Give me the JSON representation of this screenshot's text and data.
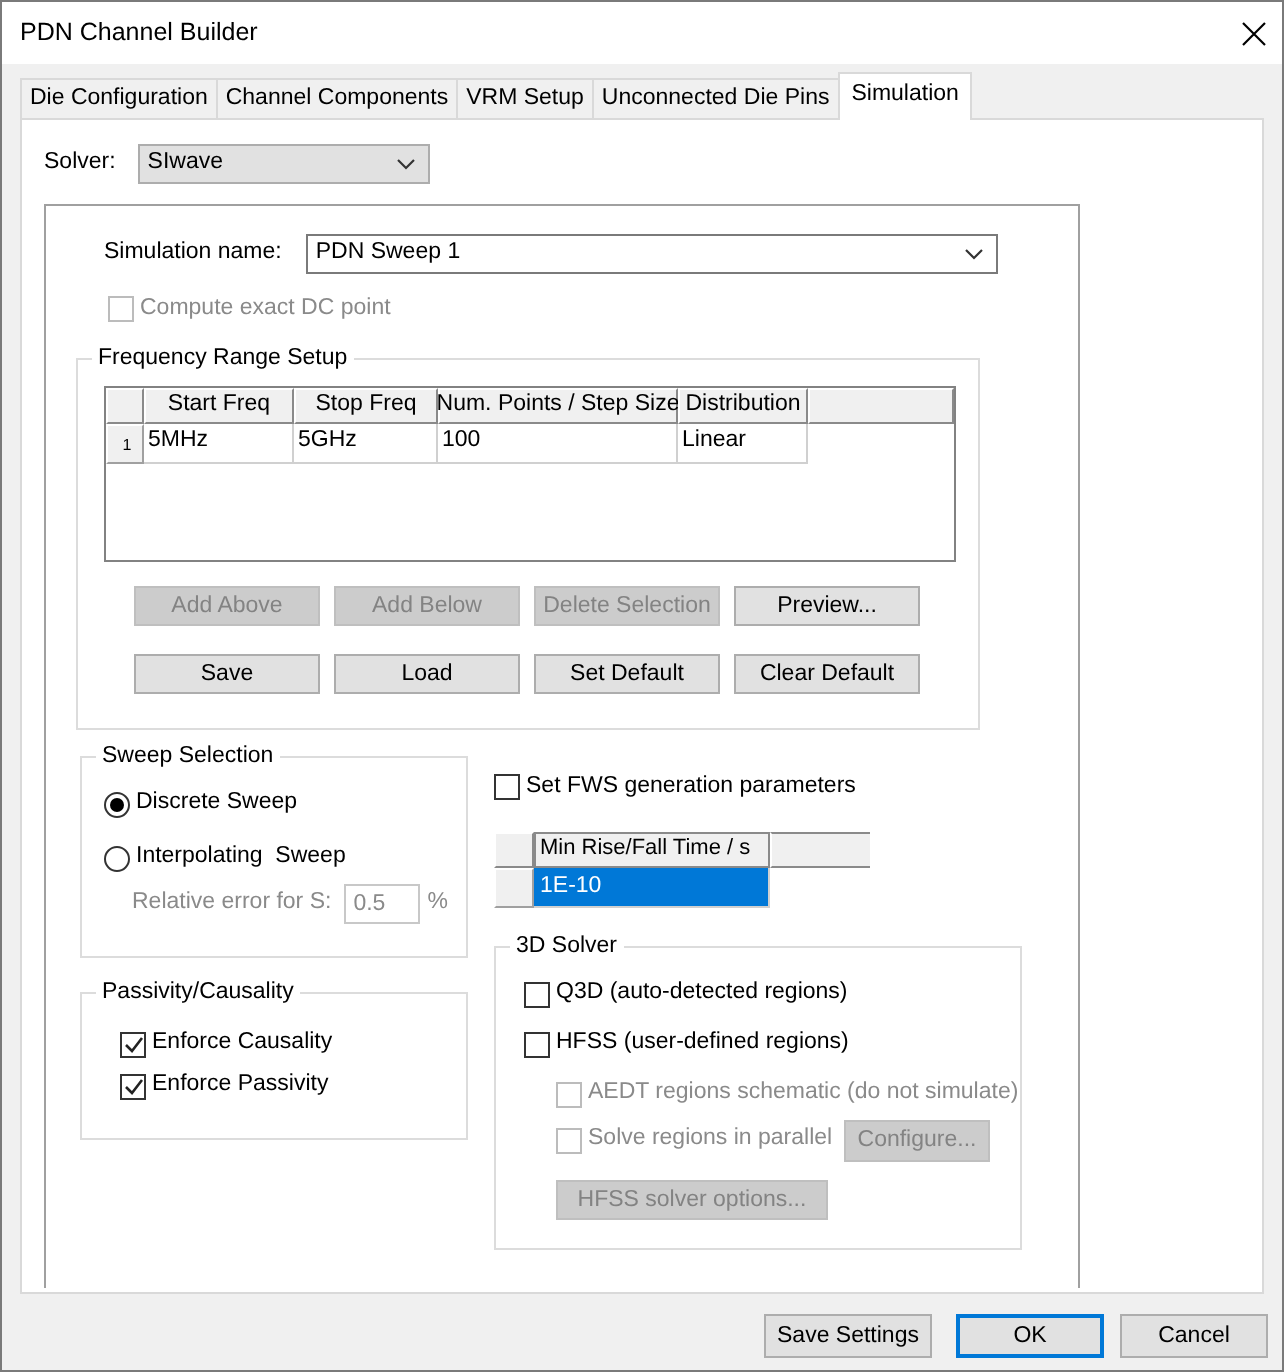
{
  "window": {
    "title": "PDN Channel Builder"
  },
  "tabs": [
    {
      "label": "Die Configuration",
      "selected": false
    },
    {
      "label": "Channel Components",
      "selected": false
    },
    {
      "label": "VRM Setup",
      "selected": false
    },
    {
      "label": "Unconnected Die Pins",
      "selected": false
    },
    {
      "label": "Simulation",
      "selected": true
    }
  ],
  "solver": {
    "label": "Solver:",
    "value": "SIwave"
  },
  "simulation_name": {
    "label": "Simulation name:",
    "value": "PDN Sweep 1"
  },
  "compute_exact_dc": {
    "label": "Compute exact DC point",
    "checked": false,
    "disabled": true
  },
  "frequency_range": {
    "title": "Frequency Range Setup",
    "columns": [
      "Start Freq",
      "Stop Freq",
      "Num. Points / Step Size",
      "Distribution"
    ],
    "rows": [
      {
        "number": "1",
        "cells": [
          "5MHz",
          "5GHz",
          "100",
          "Linear"
        ]
      }
    ],
    "button_rows": [
      [
        {
          "label": "Add Above",
          "disabled": true
        },
        {
          "label": "Add Below",
          "disabled": true
        },
        {
          "label": "Delete Selection",
          "disabled": true
        },
        {
          "label": "Preview...",
          "disabled": false
        }
      ],
      [
        {
          "label": "Save",
          "disabled": false
        },
        {
          "label": "Load",
          "disabled": false
        },
        {
          "label": "Set Default",
          "disabled": false
        },
        {
          "label": "Clear Default",
          "disabled": false
        }
      ]
    ]
  },
  "sweep_selection": {
    "title": "Sweep Selection",
    "options": [
      {
        "label": "Discrete Sweep",
        "selected": true
      },
      {
        "label": "Interpolating  Sweep",
        "selected": false
      }
    ],
    "relative_error": {
      "label": "Relative error for S:",
      "value": "0.5",
      "unit": "%",
      "disabled": true
    }
  },
  "passivity_causality": {
    "title": "Passivity/Causality",
    "options": [
      {
        "label": "Enforce Causality",
        "checked": true
      },
      {
        "label": "Enforce Passivity",
        "checked": true
      }
    ]
  },
  "fws": {
    "label": "Set FWS generation parameters",
    "checked": false,
    "columns": [
      "Min Rise/Fall Time / s"
    ],
    "rows": [
      {
        "value": "1E-10",
        "selected": true
      }
    ]
  },
  "solver_3d": {
    "title": "3D Solver",
    "options": [
      {
        "label": "Q3D (auto-detected regions)",
        "checked": false,
        "disabled": false
      },
      {
        "label": "HFSS (user-defined regions)",
        "checked": false,
        "disabled": false,
        "children": [
          {
            "label": "AEDT regions schematic (do not simulate)",
            "checked": false,
            "disabled": true
          },
          {
            "label": "Solve regions in parallel",
            "checked": false,
            "disabled": true,
            "button": {
              "label": "Configure...",
              "disabled": true
            }
          }
        ]
      }
    ],
    "button": {
      "label": "HFSS solver options...",
      "disabled": true
    }
  },
  "footer_buttons": [
    {
      "label": "Save Settings",
      "default": false
    },
    {
      "label": "OK",
      "default": true
    },
    {
      "label": "Cancel",
      "default": false
    }
  ]
}
